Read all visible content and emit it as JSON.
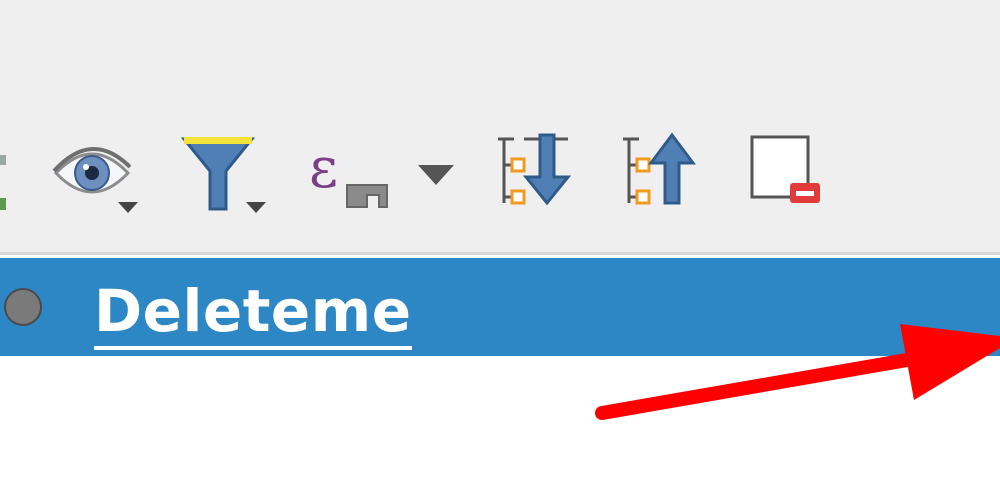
{
  "toolbar": {
    "buttons": [
      {
        "name": "layer-visibility",
        "icon": "eye-icon",
        "has_dropdown": true
      },
      {
        "name": "filter-legend",
        "icon": "funnel-icon",
        "has_dropdown": true
      },
      {
        "name": "filter-by-expression",
        "icon": "epsilon-filter-icon",
        "has_dropdown": true
      },
      {
        "name": "expand-all",
        "icon": "expand-all-icon",
        "has_dropdown": false
      },
      {
        "name": "collapse-all",
        "icon": "collapse-all-icon",
        "has_dropdown": false
      },
      {
        "name": "remove-layer",
        "icon": "remove-layer-icon",
        "has_dropdown": false
      }
    ]
  },
  "layer_tree": {
    "selected_layer": {
      "name": "Deleteme",
      "status_icon": "gray-dot-icon"
    }
  },
  "colors": {
    "selection": "#2d87c4",
    "toolbar_bg": "#efefef",
    "annotation_arrow": "#ff0000"
  }
}
